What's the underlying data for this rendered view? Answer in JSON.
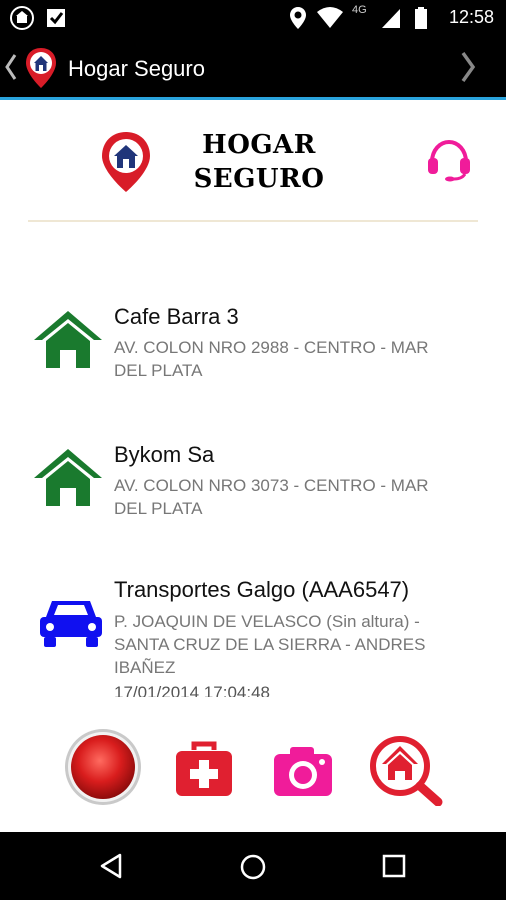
{
  "status_bar": {
    "time": "12:58",
    "network": "4G"
  },
  "action_bar": {
    "title": "Hogar Seguro"
  },
  "header": {
    "title_line1": "HOGAR",
    "title_line2": "SEGURO"
  },
  "items": [
    {
      "name": "Cafe Barra 3",
      "address": "AV. COLON NRO 2988 - CENTRO - MAR DEL PLATA",
      "icon": "house-icon"
    },
    {
      "name": "Bykom Sa",
      "address": "AV. COLON NRO 3073 - CENTRO - MAR DEL PLATA",
      "icon": "house-icon"
    },
    {
      "name": "Transportes Galgo (AAA6547)",
      "address": " P. JOAQUIN DE VELASCO (Sin altura) - SANTA CRUZ DE LA SIERRA -  ANDRES IBAÑEZ",
      "date": "17/01/2014 17:04:48",
      "icon": "car-icon"
    }
  ],
  "colors": {
    "house": "#1a7a2e",
    "car": "#1010f0",
    "accent": "#2aa4dd",
    "medical": "#e02030",
    "camera": "#f01c9a"
  }
}
